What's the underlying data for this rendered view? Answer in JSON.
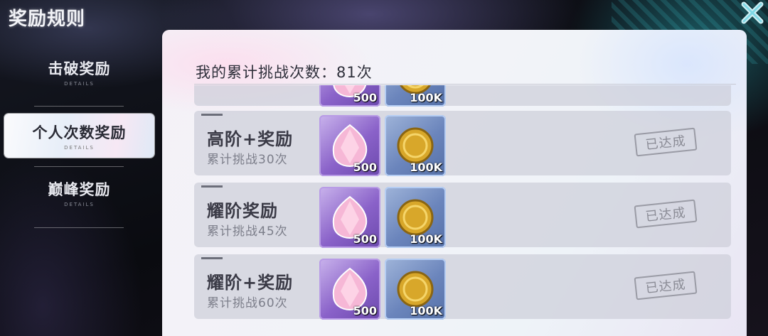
{
  "window": {
    "title": "奖励规则"
  },
  "nav": {
    "items": [
      {
        "label": "击破奖励",
        "sub": "DETAILS"
      },
      {
        "label": "个人次数奖励",
        "sub": "DETAILS"
      },
      {
        "label": "巅峰奖励",
        "sub": "DETAILS"
      }
    ],
    "active_index": 1
  },
  "panel": {
    "count_text": "我的累计挑战次数：81次",
    "rows": [
      {
        "title": "",
        "sub": "",
        "gem_qty": "500",
        "coin_qty": "100K",
        "status": ""
      },
      {
        "title": "高阶+奖励",
        "sub": "累计挑战30次",
        "gem_qty": "500",
        "coin_qty": "100K",
        "status": "已达成"
      },
      {
        "title": "耀阶奖励",
        "sub": "累计挑战45次",
        "gem_qty": "500",
        "coin_qty": "100K",
        "status": "已达成"
      },
      {
        "title": "耀阶+奖励",
        "sub": "累计挑战60次",
        "gem_qty": "500",
        "coin_qty": "100K",
        "status": "已达成"
      }
    ]
  },
  "icons": {
    "close": "close-icon",
    "gem": "pink-gem-icon",
    "coin": "gold-coin-icon"
  },
  "colors": {
    "accent_close": "#7fd8e6",
    "gem_bg": "#8a62c9",
    "coin_bg": "#6b85bc"
  }
}
